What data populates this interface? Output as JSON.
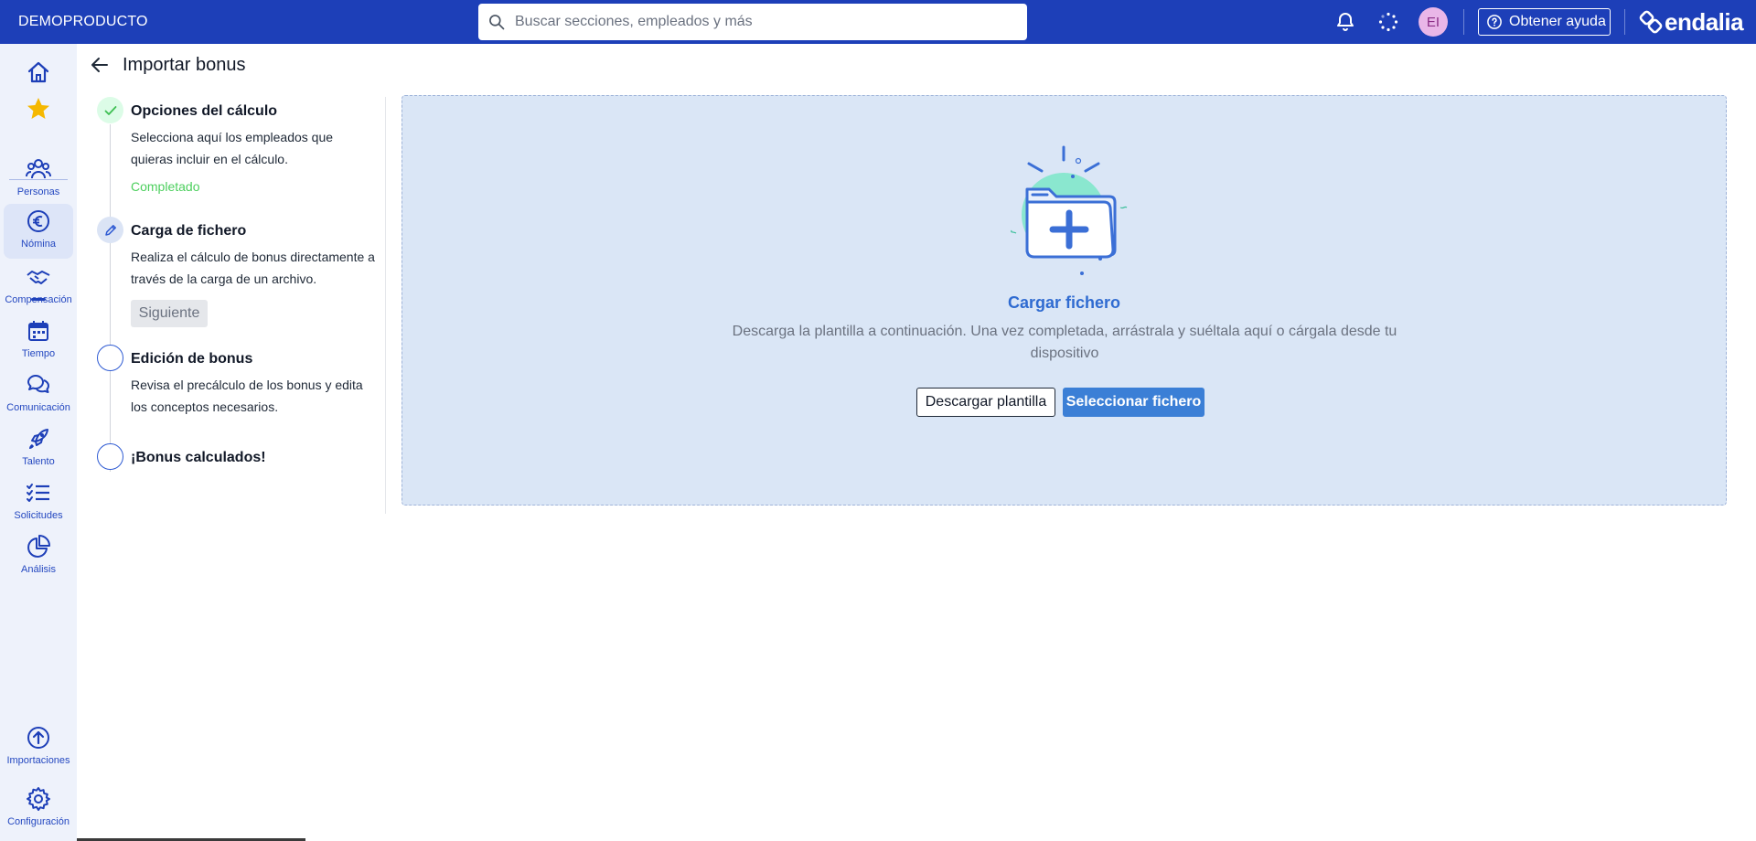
{
  "header": {
    "company": "DEMOPRODUCTO",
    "search_placeholder": "Buscar secciones, empleados y más",
    "avatar_initials": "EI",
    "help_label": "Obtener ayuda",
    "brand": "endalia",
    "colors": {
      "bar": "#1d3fb8",
      "avatar_bg": "#e9b6e8"
    },
    "icons": [
      "search-icon",
      "bell-icon",
      "loading-icon",
      "help-circle-icon",
      "endalia-logo-icon"
    ]
  },
  "sidebar": {
    "items": [
      {
        "key": "home",
        "label": "",
        "icon": "home-icon"
      },
      {
        "key": "favorites",
        "label": "",
        "icon": "star-icon"
      },
      {
        "key": "personas",
        "label": "Personas",
        "icon": "people-icon"
      },
      {
        "key": "nomina",
        "label": "Nómina",
        "icon": "euro-icon",
        "active": true
      },
      {
        "key": "compensacion",
        "label": "Compensación",
        "icon": "handshake-icon"
      },
      {
        "key": "tiempo",
        "label": "Tiempo",
        "icon": "calendar-icon"
      },
      {
        "key": "comunicacion",
        "label": "Comunicación",
        "icon": "chat-icon"
      },
      {
        "key": "talento",
        "label": "Talento",
        "icon": "rocket-icon"
      },
      {
        "key": "solicitudes",
        "label": "Solicitudes",
        "icon": "checklist-icon"
      },
      {
        "key": "analisis",
        "label": "Análisis",
        "icon": "pie-chart-icon"
      },
      {
        "key": "importaciones",
        "label": "Importaciones",
        "icon": "upload-circle-icon"
      },
      {
        "key": "configuracion",
        "label": "Configuración",
        "icon": "gear-icon"
      }
    ]
  },
  "page": {
    "title": "Importar bonus"
  },
  "stepper": {
    "steps": [
      {
        "title": "Opciones del cálculo",
        "description": "Selecciona aquí los empleados que quieras incluir en el cálculo.",
        "status": "Completado",
        "state": "done"
      },
      {
        "title": "Carga de fichero",
        "description": "Realiza el cálculo de bonus directamente a través de la carga de un archivo.",
        "button": "Siguiente",
        "state": "current"
      },
      {
        "title": "Edición de bonus",
        "description": "Revisa el precálculo de los bonus y edita los conceptos necesarios.",
        "state": "todo"
      },
      {
        "title": "¡Bonus calculados!",
        "description": "",
        "state": "todo"
      }
    ],
    "colors": {
      "completed": "#4ccf5d",
      "accent": "#2f5bd3"
    }
  },
  "upload": {
    "title": "Cargar fichero",
    "description": "Descarga la plantilla a continuación. Una vez completada, arrástrala y suéltala aquí o cárgala desde tu dispositivo",
    "download_label": "Descargar plantilla",
    "select_label": "Seleccionar fichero",
    "colors": {
      "zone_bg": "#dae6f6",
      "primary": "#3b7fd6"
    }
  }
}
